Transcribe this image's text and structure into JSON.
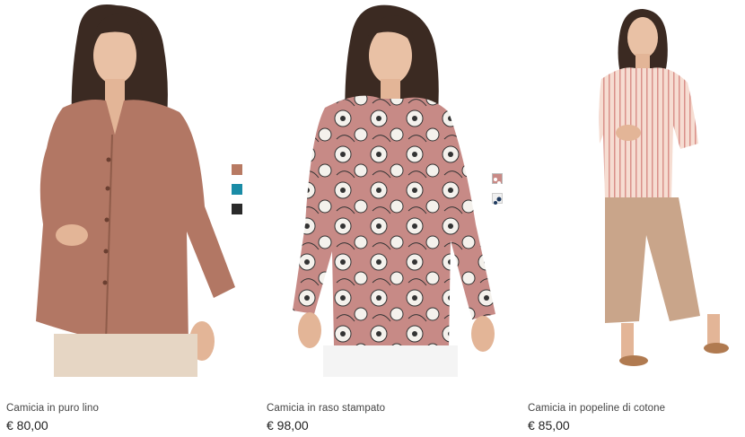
{
  "products": [
    {
      "name": "Camicia in puro lino",
      "price": "€ 80,00",
      "swatches": [
        {
          "color": "#b87a63",
          "pattern": "solid"
        },
        {
          "color": "#1a8ca6",
          "pattern": "solid"
        },
        {
          "color": "#2a2a2a",
          "pattern": "solid"
        }
      ]
    },
    {
      "name": "Camicia in raso stampato",
      "price": "€ 98,00",
      "swatches": [
        {
          "color": "#c98a86",
          "pattern": "floral"
        },
        {
          "color": "#f0f0f0",
          "pattern": "floral-navy"
        }
      ]
    },
    {
      "name": "Camicia in popeline di cotone",
      "price": "€ 85,00",
      "swatches": []
    }
  ]
}
